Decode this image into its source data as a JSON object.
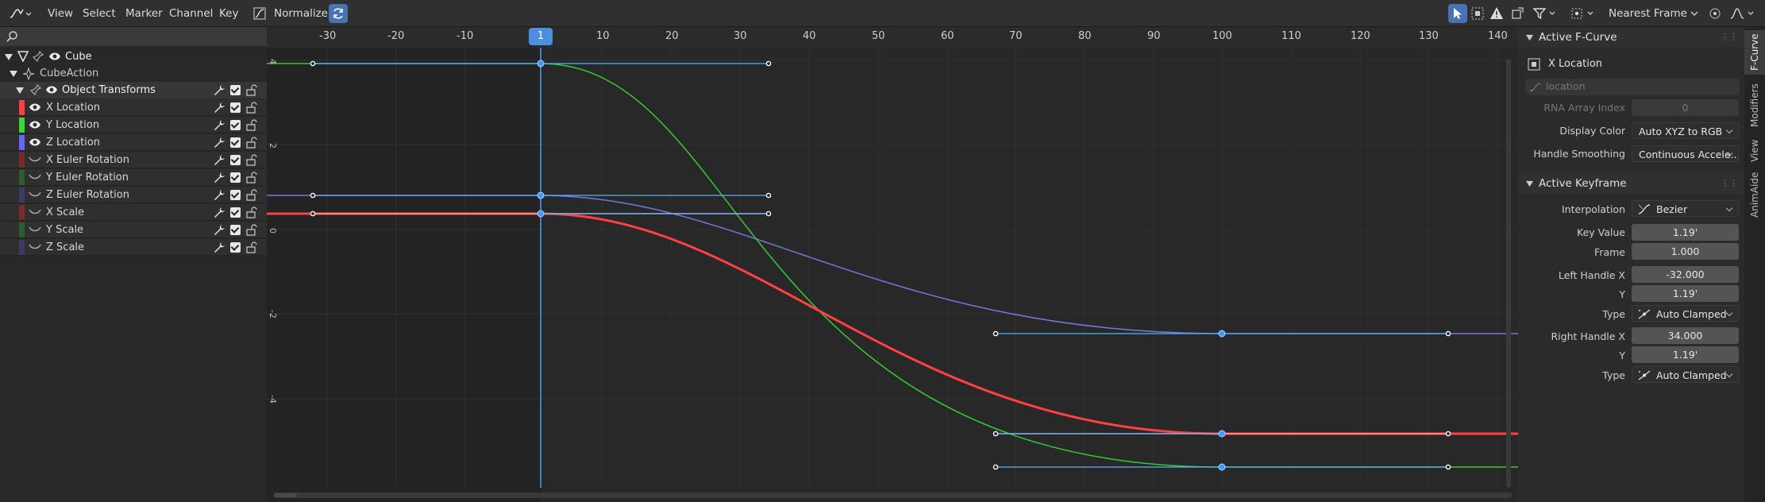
{
  "header": {
    "menus": [
      "View",
      "Select",
      "Marker",
      "Channel",
      "Key"
    ],
    "normalize_label": "Normalize",
    "snap_mode": "Nearest Frame"
  },
  "channels": {
    "object": "Cube",
    "action": "CubeAction",
    "group": "Object Transforms",
    "items": [
      {
        "label": "X Location",
        "color": "#ff3f3f",
        "visible": true
      },
      {
        "label": "Y Location",
        "color": "#33dd33",
        "visible": true
      },
      {
        "label": "Z Location",
        "color": "#6666ff",
        "visible": true
      },
      {
        "label": "X Euler Rotation",
        "color": "#7a2a2a",
        "visible": false
      },
      {
        "label": "Y Euler Rotation",
        "color": "#2a5e2a",
        "visible": false
      },
      {
        "label": "Z Euler Rotation",
        "color": "#3a3a6a",
        "visible": false
      },
      {
        "label": "X Scale",
        "color": "#7a2a2a",
        "visible": false
      },
      {
        "label": "Y Scale",
        "color": "#2a5e2a",
        "visible": false
      },
      {
        "label": "Z Scale",
        "color": "#3a3a6a",
        "visible": false
      }
    ]
  },
  "graph": {
    "current_frame": "1",
    "frame_ticks": [
      "-30",
      "-20",
      "-10",
      "10",
      "20",
      "30",
      "40",
      "50",
      "60",
      "70",
      "80",
      "90",
      "100",
      "110",
      "120",
      "130",
      "140"
    ],
    "value_ticks": [
      "4",
      "2",
      "0",
      "-2",
      "-4"
    ]
  },
  "sidebar": {
    "active_fcurve_title": "Active F-Curve",
    "fcurve_name": "X Location",
    "data_path": "location",
    "rna_index_label": "RNA Array Index",
    "rna_index_value": "0",
    "display_color_label": "Display Color",
    "display_color_value": "Auto XYZ to RGB",
    "handle_smoothing_label": "Handle Smoothing",
    "handle_smoothing_value": "Continuous Accele...",
    "active_keyframe_title": "Active Keyframe",
    "interpolation_label": "Interpolation",
    "interpolation_value": "Bezier",
    "key_value_label": "Key Value",
    "key_value": "1.19'",
    "frame_label": "Frame",
    "frame_value": "1.000",
    "left_handle_x_label": "Left Handle X",
    "left_handle_x": "-32.000",
    "left_y_label": "Y",
    "left_y": "1.19'",
    "left_type_label": "Type",
    "left_type": "Auto Clamped",
    "right_handle_x_label": "Right Handle X",
    "right_handle_x": "34.000",
    "right_y_label": "Y",
    "right_y": "1.19'",
    "right_type_label": "Type",
    "right_type": "Auto Clamped"
  },
  "tabs": [
    "F-Curve",
    "Modifiers",
    "View",
    "AnimAide"
  ]
}
